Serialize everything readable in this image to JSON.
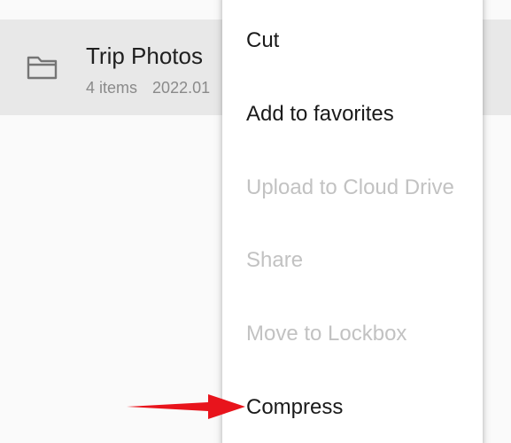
{
  "file": {
    "name": "Trip Photos",
    "item_count": "4 items",
    "date": "2022.01"
  },
  "icons": {
    "folder": "folder-icon",
    "arrow": "arrow-right-icon"
  },
  "colors": {
    "arrow": "#e8141c",
    "disabled_text": "#c2c2c2",
    "selected_row": "#e8e8e8"
  },
  "menu": {
    "items": [
      {
        "label": "Cut",
        "enabled": true
      },
      {
        "label": "Add to favorites",
        "enabled": true
      },
      {
        "label": "Upload to Cloud Drive",
        "enabled": false
      },
      {
        "label": "Share",
        "enabled": false
      },
      {
        "label": "Move to Lockbox",
        "enabled": false
      },
      {
        "label": "Compress",
        "enabled": true
      }
    ]
  }
}
